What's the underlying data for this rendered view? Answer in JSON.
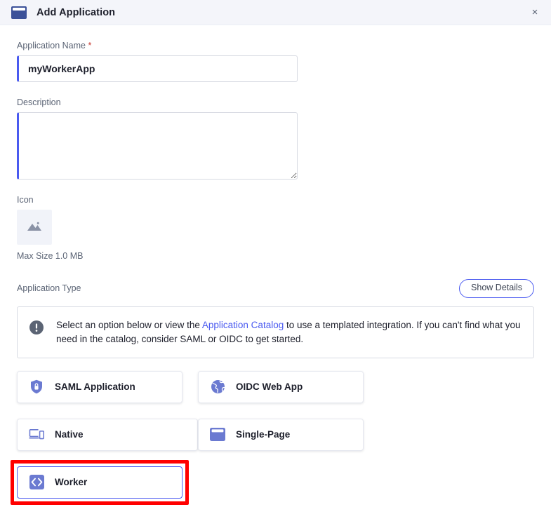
{
  "header": {
    "title": "Add Application",
    "app_icon": "browser-window-icon",
    "close_label": "×"
  },
  "form": {
    "name_field": {
      "label": "Application Name",
      "required_marker": "*",
      "value": "myWorkerApp",
      "placeholder": ""
    },
    "description_field": {
      "label": "Description",
      "value": "",
      "placeholder": ""
    },
    "icon_field": {
      "label": "Icon",
      "placeholder_icon": "image-placeholder-icon",
      "max_size_text": "Max Size 1.0 MB"
    }
  },
  "application_type": {
    "label": "Application Type",
    "show_details_label": "Show Details",
    "callout": {
      "icon": "exclamation-circle-icon",
      "text_before_link": "Select an option below or view the ",
      "link_text": "Application Catalog",
      "text_after_link": " to use a templated integration. If you can't find what you need in the catalog, consider SAML or OIDC to get started."
    },
    "options": [
      {
        "label": "SAML Application",
        "icon": "shield-lock-icon",
        "selected": false
      },
      {
        "label": "OIDC Web App",
        "icon": "globe-icon",
        "selected": false
      },
      {
        "label": "Native",
        "icon": "devices-icon",
        "selected": false
      },
      {
        "label": "Single-Page",
        "icon": "browser-window-icon",
        "selected": false
      },
      {
        "label": "Worker",
        "icon": "code-brackets-icon",
        "selected": true
      }
    ]
  },
  "colors": {
    "accent": "#4a5af0",
    "icon_purple": "#6b7ad1",
    "header_bg": "#f4f5fa",
    "highlight_red": "#ff0000",
    "required_red": "#c7382f"
  }
}
